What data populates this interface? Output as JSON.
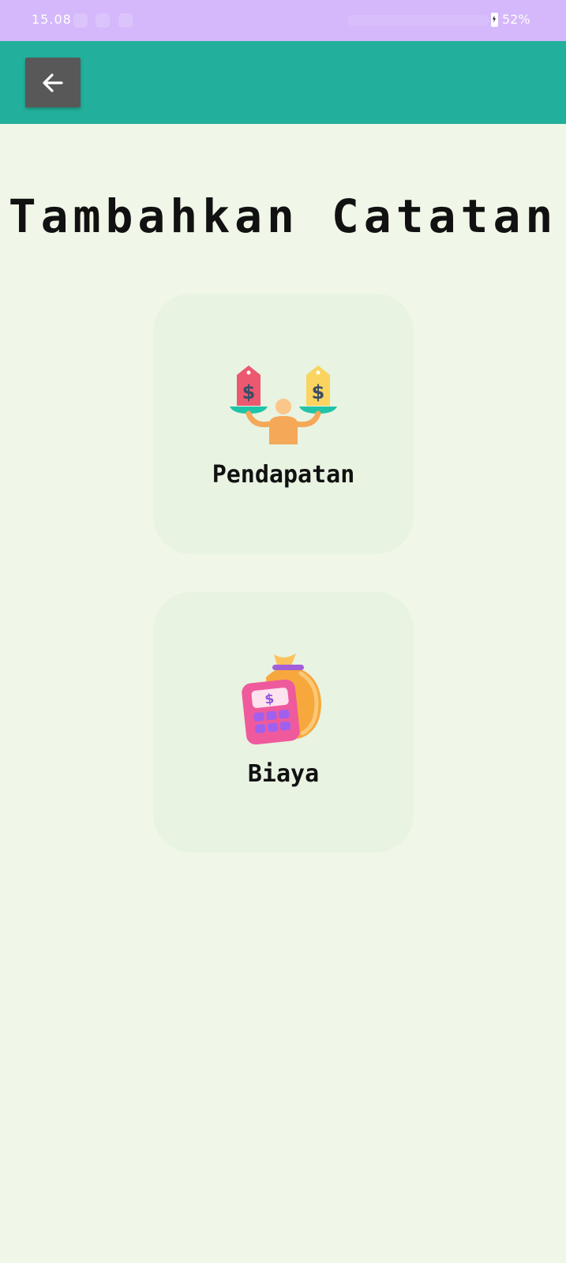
{
  "status_bar": {
    "time": "15.08",
    "battery": "52%"
  },
  "app_bar": {
    "back_icon": "arrow-left-icon"
  },
  "page": {
    "title": "Tambahkan Catatan"
  },
  "options": [
    {
      "label": "Pendapatan",
      "icon": "income-balance-icon"
    },
    {
      "label": "Biaya",
      "icon": "money-bag-calculator-icon"
    }
  ],
  "colors": {
    "status_bar": "#d4b8fb",
    "app_bar": "#22b09c",
    "background": "#f0f7e8",
    "card": "#e8f3e2",
    "back_button": "#585858"
  }
}
